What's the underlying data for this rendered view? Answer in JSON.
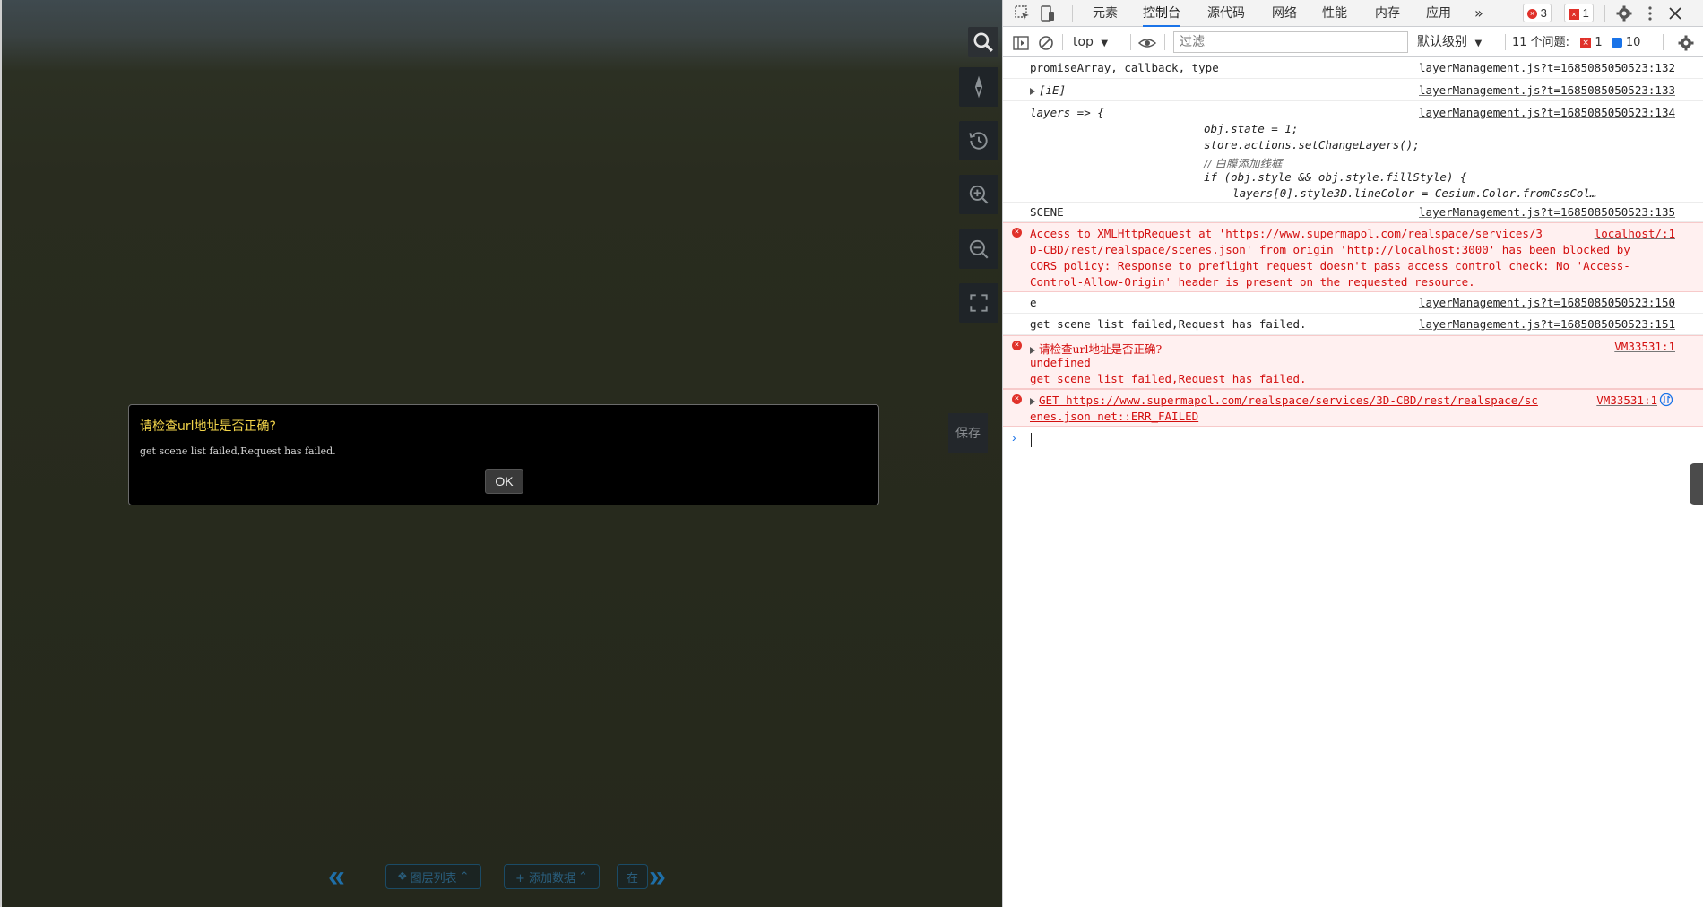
{
  "viewport": {
    "toolbar": {
      "save_label": "保存"
    },
    "alert": {
      "title": "请检查url地址是否正确?",
      "message": "get scene list failed,Request has failed.",
      "ok_label": "OK"
    },
    "bottom_nav": {
      "prev_icon": "double-chevron-left",
      "next_icon": "double-chevron-right",
      "items": [
        {
          "label": "图层列表"
        },
        {
          "label": "+ 添加数据"
        },
        {
          "label": "在"
        }
      ]
    }
  },
  "devtools": {
    "tabs": [
      "元素",
      "控制台",
      "源代码",
      "网络",
      "性能",
      "内存",
      "应用"
    ],
    "active_tab": "控制台",
    "more_label": "»",
    "errors_count": "3",
    "issues_badge_count": "1",
    "context_selector": "top",
    "filter_placeholder": "过滤",
    "level_selector": "默认级别",
    "issues_summary": "11 个问题:",
    "issues_errors": "1",
    "issues_info": "10",
    "console_rows": [
      {
        "type": "log",
        "text": "promiseArray, callback, type",
        "source": "layerManagement.js?t=1685085050523:132"
      },
      {
        "type": "log",
        "text": "[iE]",
        "source": "layerManagement.js?t=1685085050523:133"
      },
      {
        "type": "log",
        "text": "layers => {",
        "source": "layerManagement.js?t=1685085050523:134",
        "code_lines": [
          "obj.state = 1;",
          "store.actions.setChangeLayers();",
          "// 白膜添加线框",
          "if (obj.style && obj.style.fillStyle) {",
          "  layers[0].style3D.lineColor = Cesium.Color.fromCssCol…"
        ]
      },
      {
        "type": "log",
        "text": "SCENE",
        "source": "layerManagement.js?t=1685085050523:135"
      },
      {
        "type": "error",
        "lines": [
          "Access to XMLHttpRequest at 'https://www.supermapol.com/realspace/services/3",
          "D-CBD/rest/realspace/scenes.json' from origin 'http://localhost:3000' has been blocked by",
          "CORS policy: Response to preflight request doesn't pass access control check: No 'Access-",
          "Control-Allow-Origin' header is present on the requested resource."
        ],
        "source": "localhost/:1"
      },
      {
        "type": "log",
        "text": "e",
        "source": "layerManagement.js?t=1685085050523:150"
      },
      {
        "type": "log",
        "text": "get scene list failed,Request has failed.",
        "source": "layerManagement.js?t=1685085050523:151"
      },
      {
        "type": "error",
        "lines": [
          "请检查url地址是否正确?",
          "undefined",
          "get scene list failed,Request has failed."
        ],
        "source": "VM33531:1"
      },
      {
        "type": "error",
        "lines": [
          "GET https://www.supermapol.com/realspace/services/3D-CBD/rest/realspace/sc",
          "enes.json net::ERR_FAILED"
        ],
        "source": "VM33531:1"
      }
    ]
  }
}
